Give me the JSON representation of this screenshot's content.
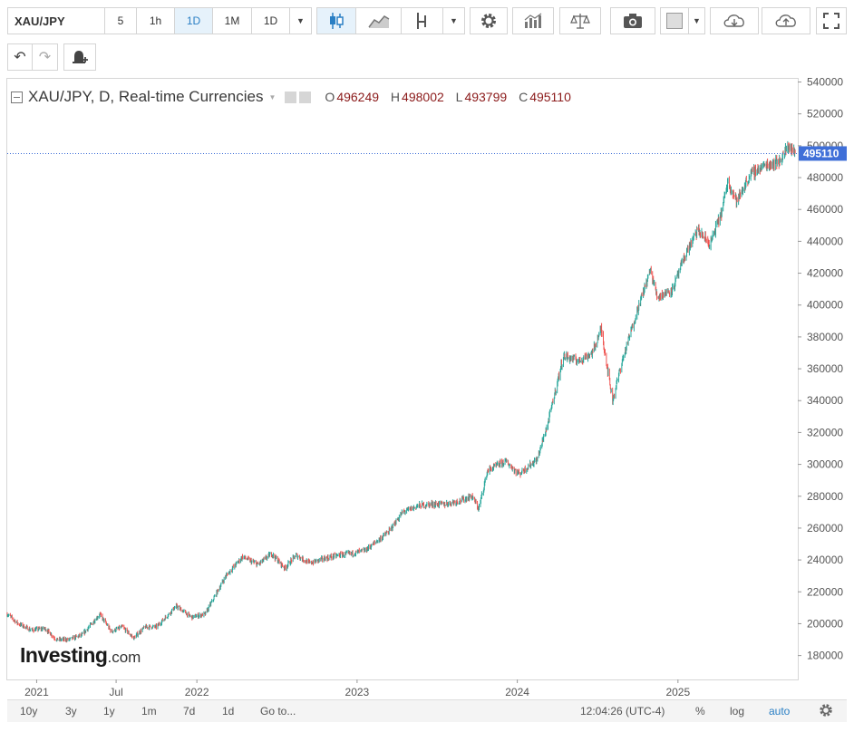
{
  "toolbar": {
    "symbol": "XAU/JPY",
    "intervals": [
      "5",
      "1h",
      "1D",
      "1M",
      "1D"
    ],
    "active_interval": "1D"
  },
  "legend": {
    "title": "XAU/JPY, D, Real-time Currencies",
    "open_label": "O",
    "open": "496249",
    "high_label": "H",
    "high": "498002",
    "low_label": "L",
    "low": "493799",
    "close_label": "C",
    "close": "495110"
  },
  "last_price_label": "495110",
  "logo": {
    "brand": "Investing",
    "suffix": ".com"
  },
  "bottom": {
    "ranges": [
      "10y",
      "3y",
      "1y",
      "1m",
      "7d",
      "1d"
    ],
    "goto": "Go to...",
    "time": "12:04:26 (UTC-4)",
    "percent": "%",
    "log": "log",
    "auto": "auto"
  },
  "colors": {
    "up": "#26a69a",
    "down": "#ef5350",
    "price_tag": "#3f6fd8",
    "accent": "#2a7fc4"
  },
  "chart_data": {
    "type": "line",
    "title": "XAU/JPY, D, Real-time Currencies",
    "series": [
      {
        "values": [
          [
            "2020-10-26",
            206000
          ],
          [
            "2020-11-20",
            200000
          ],
          [
            "2020-12-20",
            196000
          ],
          [
            "2021-01-20",
            197000
          ],
          [
            "2021-02-15",
            190000
          ],
          [
            "2021-03-15",
            190000
          ],
          [
            "2021-04-15",
            193000
          ],
          [
            "2021-05-25",
            206000
          ],
          [
            "2021-06-20",
            195000
          ],
          [
            "2021-07-15",
            198000
          ],
          [
            "2021-08-10",
            191000
          ],
          [
            "2021-09-05",
            198000
          ],
          [
            "2021-10-01",
            198000
          ],
          [
            "2021-11-15",
            211000
          ],
          [
            "2021-12-20",
            204000
          ],
          [
            "2022-01-20",
            206000
          ],
          [
            "2022-03-08",
            230000
          ],
          [
            "2022-04-15",
            242000
          ],
          [
            "2022-05-20",
            237000
          ],
          [
            "2022-06-20",
            244000
          ],
          [
            "2022-07-20",
            235000
          ],
          [
            "2022-08-15",
            243000
          ],
          [
            "2022-09-15",
            238000
          ],
          [
            "2022-10-20",
            241000
          ],
          [
            "2022-11-20",
            243000
          ],
          [
            "2022-12-20",
            244000
          ],
          [
            "2023-01-20",
            246000
          ],
          [
            "2023-03-15",
            258000
          ],
          [
            "2023-04-15",
            270000
          ],
          [
            "2023-05-20",
            274000
          ],
          [
            "2023-06-20",
            275000
          ],
          [
            "2023-07-20",
            275000
          ],
          [
            "2023-08-20",
            277000
          ],
          [
            "2023-09-20",
            280000
          ],
          [
            "2023-10-05",
            272000
          ],
          [
            "2023-10-25",
            296000
          ],
          [
            "2023-12-05",
            302000
          ],
          [
            "2024-01-05",
            294000
          ],
          [
            "2024-02-15",
            303000
          ],
          [
            "2024-03-10",
            325000
          ],
          [
            "2024-04-15",
            368000
          ],
          [
            "2024-05-20",
            365000
          ],
          [
            "2024-06-20",
            370000
          ],
          [
            "2024-07-10",
            385000
          ],
          [
            "2024-08-05",
            340000
          ],
          [
            "2024-08-25",
            363000
          ],
          [
            "2024-09-25",
            392000
          ],
          [
            "2024-10-30",
            422000
          ],
          [
            "2024-11-15",
            405000
          ],
          [
            "2024-12-20",
            410000
          ],
          [
            "2025-01-20",
            433000
          ],
          [
            "2025-02-15",
            447000
          ],
          [
            "2025-03-15",
            438000
          ],
          [
            "2025-04-10",
            458000
          ],
          [
            "2025-04-25",
            478000
          ],
          [
            "2025-05-15",
            465000
          ],
          [
            "2025-06-15",
            482000
          ],
          [
            "2025-07-20",
            488000
          ],
          [
            "2025-08-20",
            490000
          ],
          [
            "2025-09-10",
            500000
          ],
          [
            "2025-09-25",
            495110
          ]
        ]
      }
    ],
    "x_ticks": [
      "2021",
      "Jul",
      "2022",
      "2023",
      "2024",
      "2025"
    ],
    "y_ticks": [
      180000,
      200000,
      220000,
      240000,
      260000,
      280000,
      300000,
      320000,
      340000,
      360000,
      380000,
      400000,
      420000,
      440000,
      460000,
      480000,
      500000,
      520000,
      540000
    ],
    "ylim": [
      165000,
      542000
    ],
    "xlim": [
      "2020-10-26",
      "2025-10-01"
    ],
    "last_price": 495110,
    "grid": false,
    "legend": "top-left"
  }
}
